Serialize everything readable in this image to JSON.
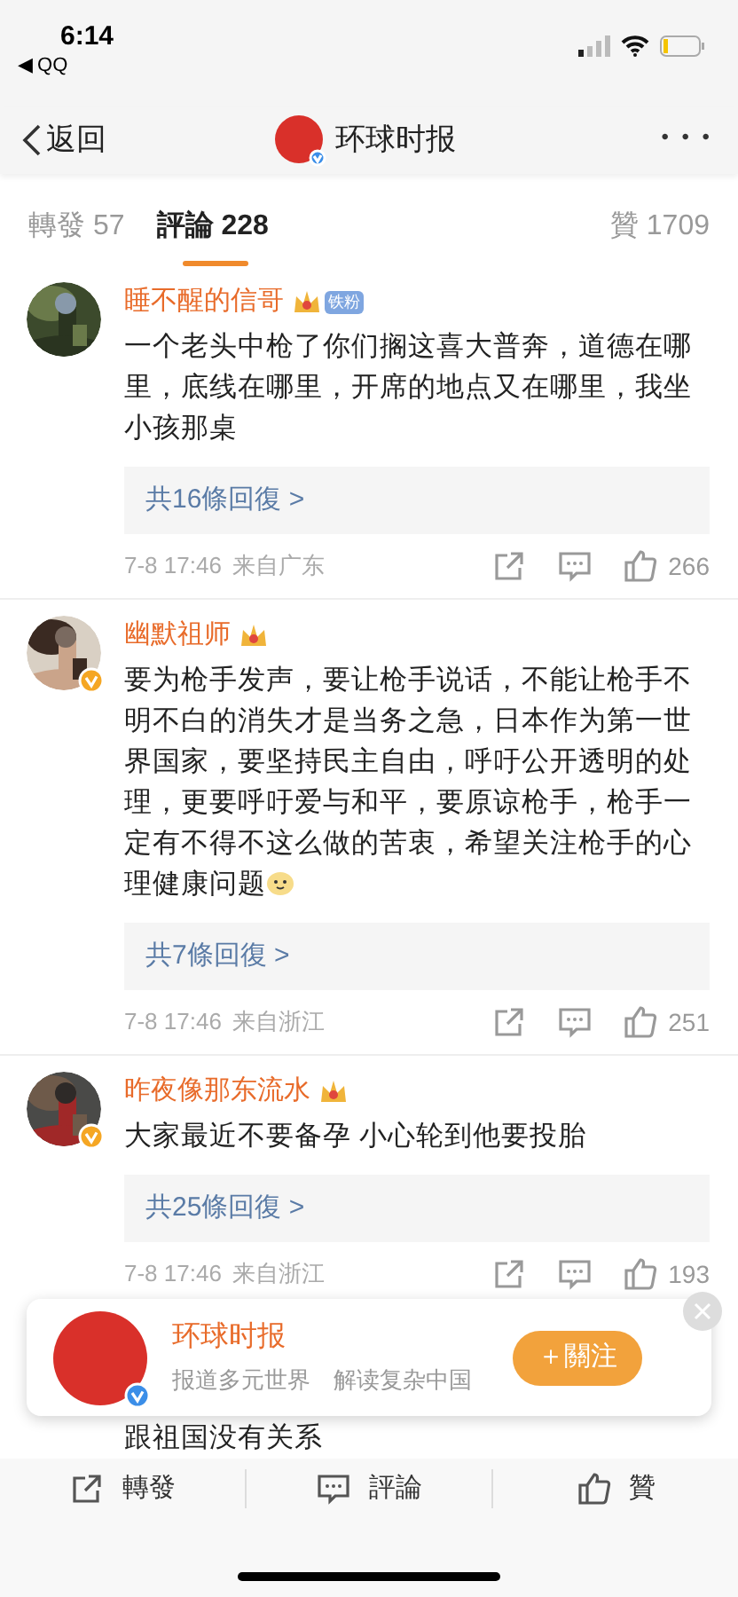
{
  "status_bar": {
    "time": "6:14",
    "back_app": "◀ QQ"
  },
  "nav": {
    "back": "返回",
    "title": "环球时报",
    "more": "• • •"
  },
  "tabs": [
    {
      "label": "轉發 57",
      "selected": false
    },
    {
      "label": "評論 228",
      "selected": true
    },
    {
      "label": "贊 1709",
      "selected": false
    }
  ],
  "comments": [
    {
      "name": "睡不醒的信哥",
      "fan_badge": "铁粉",
      "verified": false,
      "text": "一个老头中枪了你们搁这喜大普奔，道德在哪里，底线在哪里，开席的地点又在哪里，我坐小孩那桌",
      "emoji": false,
      "replies": "共16條回復 >",
      "time": "7-8 17:46",
      "location": "来自广东",
      "likes": "266"
    },
    {
      "name": "幽默祖师",
      "verified": true,
      "text": "要为枪手发声，要让枪手说话，不能让枪手不明不白的消失才是当务之急，日本作为第一世界国家，要坚持民主自由，呼吁公开透明的处理，更要呼吁爱与和平，要原谅枪手，枪手一定有不得不这么做的苦衷，希望关注枪手的心理健康问题",
      "emoji": true,
      "replies": "共7條回復 >",
      "time": "7-8 17:46",
      "location": "来自浙江",
      "likes": "251"
    },
    {
      "name": "昨夜像那东流水",
      "verified": true,
      "text": "大家最近不要备孕 小心轮到他要投胎",
      "emoji": false,
      "replies": "共25條回復 >",
      "time": "7-8 17:46",
      "location": "来自浙江",
      "likes": "193"
    }
  ],
  "partial_text": "跟祖国没有关系",
  "follow_banner": {
    "name": "环球时报",
    "slogan": "报道多元世界　解读复杂中国",
    "button": "＋關注"
  },
  "bottom_bar": [
    {
      "label": "轉發",
      "kind": "repost"
    },
    {
      "label": "評論",
      "kind": "comment"
    },
    {
      "label": "贊",
      "kind": "like"
    }
  ]
}
